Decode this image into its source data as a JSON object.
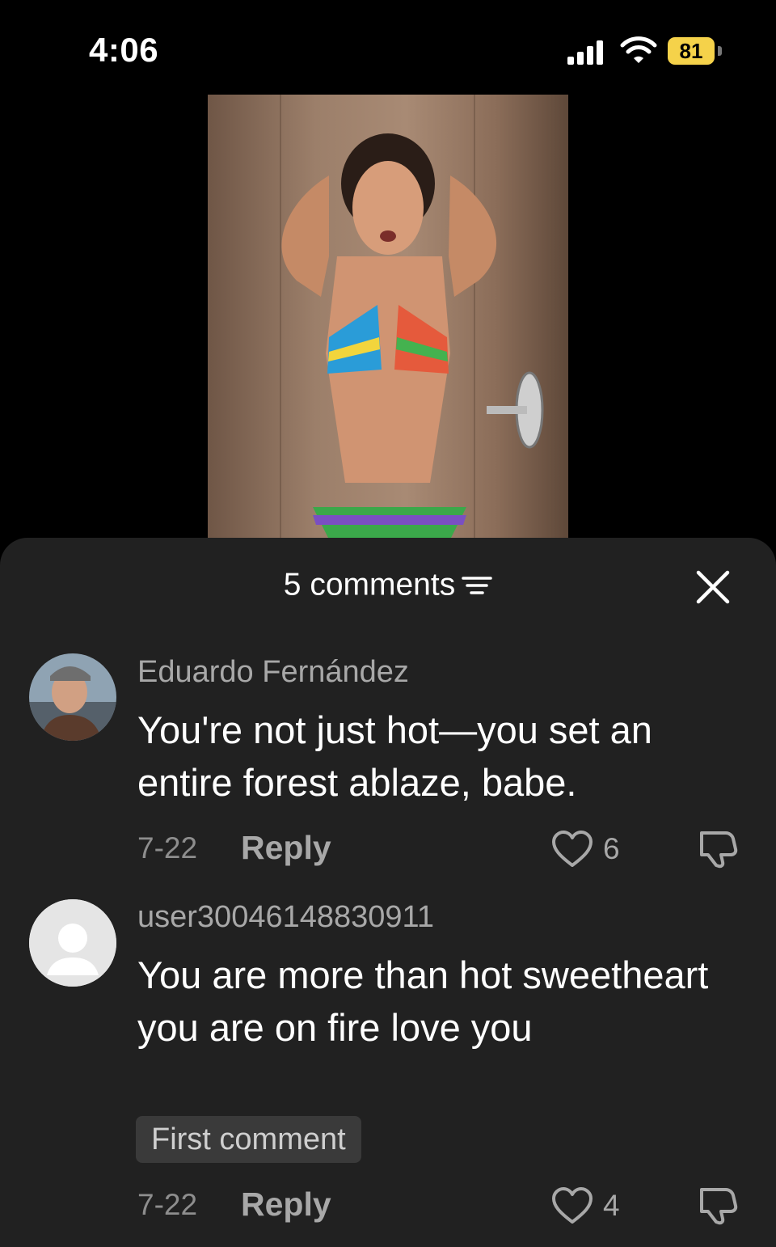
{
  "status_bar": {
    "time": "4:06",
    "battery": "81"
  },
  "comments_panel": {
    "title": "5 comments",
    "comments": [
      {
        "username": "Eduardo Fernández",
        "text": "You're not just hot—you set an entire forest ablaze, babe.",
        "date": "7-22",
        "reply_label": "Reply",
        "likes": "6"
      },
      {
        "username": "user30046148830911",
        "text": "You are more than hot sweetheart you are on fire love you",
        "badge": "First comment",
        "date": "7-22",
        "reply_label": "Reply",
        "likes": "4"
      }
    ]
  }
}
